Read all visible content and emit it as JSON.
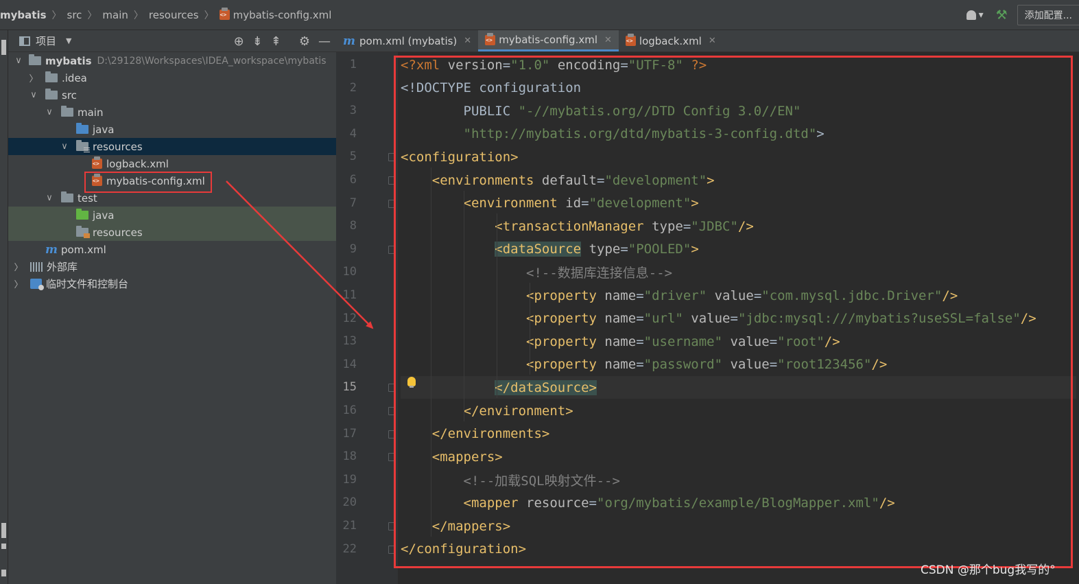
{
  "breadcrumbs": [
    "mybatis",
    "src",
    "main",
    "resources",
    "mybatis-config.xml"
  ],
  "toolbar": {
    "add_config_label": "添加配置..."
  },
  "project_panel": {
    "title": "项目",
    "tree": [
      {
        "label": "mybatis",
        "path": "D:\\29128\\Workspaces\\IDEA_workspace\\mybatis",
        "arrow": "∨",
        "icon": "module-folder-icon"
      },
      {
        "label": ".idea",
        "arrow": "〉",
        "icon": "folder-icon"
      },
      {
        "label": "src",
        "arrow": "∨",
        "icon": "folder-icon"
      },
      {
        "label": "main",
        "arrow": "∨",
        "icon": "folder-icon"
      },
      {
        "label": "java",
        "icon": "source-folder-icon"
      },
      {
        "label": "resources",
        "arrow": "∨",
        "icon": "resources-folder-icon"
      },
      {
        "label": "logback.xml",
        "icon": "xml-file-icon"
      },
      {
        "label": "mybatis-config.xml",
        "icon": "xml-file-icon"
      },
      {
        "label": "test",
        "arrow": "∨",
        "icon": "folder-icon"
      },
      {
        "label": "java",
        "icon": "test-source-folder-icon"
      },
      {
        "label": "resources",
        "icon": "test-resources-folder-icon"
      },
      {
        "label": "pom.xml",
        "icon": "maven-icon"
      },
      {
        "label": "外部库",
        "arrow": "〉",
        "icon": "libraries-icon"
      },
      {
        "label": "临时文件和控制台",
        "arrow": "〉",
        "icon": "scratches-icon"
      }
    ]
  },
  "tabs": [
    {
      "label": "pom.xml (mybatis)",
      "icon": "maven-icon",
      "active": false
    },
    {
      "label": "mybatis-config.xml",
      "icon": "xml-file-icon",
      "active": true
    },
    {
      "label": "logback.xml",
      "icon": "xml-file-icon",
      "active": false
    }
  ],
  "editor": {
    "current_line": 15,
    "lines": [
      [
        [
          "dt",
          "<?xml "
        ],
        [
          "attr",
          "version"
        ],
        [
          "txt",
          "="
        ],
        [
          "val",
          "\"1.0\""
        ],
        [
          "txt",
          " "
        ],
        [
          "attr",
          "encoding"
        ],
        [
          "txt",
          "="
        ],
        [
          "val",
          "\"UTF-8\""
        ],
        [
          "dt",
          " ?>"
        ]
      ],
      [
        [
          "txt",
          "<!DOCTYPE configuration"
        ]
      ],
      [
        [
          "txt",
          "        PUBLIC "
        ],
        [
          "val",
          "\"-//mybatis.org//DTD Config 3.0//EN\""
        ]
      ],
      [
        [
          "txt",
          "        "
        ],
        [
          "val",
          "\"http://mybatis.org/dtd/mybatis-3-config.dtd\""
        ],
        [
          "txt",
          ">"
        ]
      ],
      [
        [
          "tag",
          "<configuration>"
        ]
      ],
      [
        [
          "txt",
          "    "
        ],
        [
          "tag",
          "<environments "
        ],
        [
          "attr",
          "default"
        ],
        [
          "txt",
          "="
        ],
        [
          "val",
          "\"development\""
        ],
        [
          "tag",
          ">"
        ]
      ],
      [
        [
          "txt",
          "        "
        ],
        [
          "tag",
          "<environment "
        ],
        [
          "attr",
          "id"
        ],
        [
          "txt",
          "="
        ],
        [
          "val",
          "\"development\""
        ],
        [
          "tag",
          ">"
        ]
      ],
      [
        [
          "txt",
          "            "
        ],
        [
          "tag",
          "<transactionManager "
        ],
        [
          "attr",
          "type"
        ],
        [
          "txt",
          "="
        ],
        [
          "val",
          "\"JDBC\""
        ],
        [
          "tag",
          "/>"
        ]
      ],
      [
        [
          "txt",
          "            "
        ],
        [
          "match",
          "<dataSource"
        ],
        [
          "txt",
          " "
        ],
        [
          "attr",
          "type"
        ],
        [
          "txt",
          "="
        ],
        [
          "val",
          "\"POOLED\""
        ],
        [
          "tag",
          ">"
        ]
      ],
      [
        [
          "txt",
          "                "
        ],
        [
          "cm",
          "<!--数据库连接信息-->"
        ]
      ],
      [
        [
          "txt",
          "                "
        ],
        [
          "tag",
          "<property "
        ],
        [
          "attr",
          "name"
        ],
        [
          "txt",
          "="
        ],
        [
          "val",
          "\"driver\""
        ],
        [
          "txt",
          " "
        ],
        [
          "attr",
          "value"
        ],
        [
          "txt",
          "="
        ],
        [
          "val",
          "\"com.mysql.jdbc.Driver\""
        ],
        [
          "tag",
          "/>"
        ]
      ],
      [
        [
          "txt",
          "                "
        ],
        [
          "tag",
          "<property "
        ],
        [
          "attr",
          "name"
        ],
        [
          "txt",
          "="
        ],
        [
          "val",
          "\"url\""
        ],
        [
          "txt",
          " "
        ],
        [
          "attr",
          "value"
        ],
        [
          "txt",
          "="
        ],
        [
          "val",
          "\"jdbc:mysql:///mybatis?useSSL=false\""
        ],
        [
          "tag",
          "/>"
        ]
      ],
      [
        [
          "txt",
          "                "
        ],
        [
          "tag",
          "<property "
        ],
        [
          "attr",
          "name"
        ],
        [
          "txt",
          "="
        ],
        [
          "val",
          "\"username\""
        ],
        [
          "txt",
          " "
        ],
        [
          "attr",
          "value"
        ],
        [
          "txt",
          "="
        ],
        [
          "val",
          "\"root\""
        ],
        [
          "tag",
          "/>"
        ]
      ],
      [
        [
          "txt",
          "                "
        ],
        [
          "tag",
          "<property "
        ],
        [
          "attr",
          "name"
        ],
        [
          "txt",
          "="
        ],
        [
          "val",
          "\"password\""
        ],
        [
          "txt",
          " "
        ],
        [
          "attr",
          "value"
        ],
        [
          "txt",
          "="
        ],
        [
          "val",
          "\"root123456\""
        ],
        [
          "tag",
          "/>"
        ]
      ],
      [
        [
          "txt",
          "            "
        ],
        [
          "match",
          "</dataSource>"
        ]
      ],
      [
        [
          "txt",
          "        "
        ],
        [
          "tag",
          "</environment>"
        ]
      ],
      [
        [
          "txt",
          "    "
        ],
        [
          "tag",
          "</environments>"
        ]
      ],
      [
        [
          "txt",
          "    "
        ],
        [
          "tag",
          "<mappers>"
        ]
      ],
      [
        [
          "txt",
          "        "
        ],
        [
          "cm",
          "<!--加载SQL映射文件-->"
        ]
      ],
      [
        [
          "txt",
          "        "
        ],
        [
          "tag",
          "<mapper "
        ],
        [
          "attr",
          "resource"
        ],
        [
          "txt",
          "="
        ],
        [
          "val",
          "\"org/mybatis/example/BlogMapper.xml\""
        ],
        [
          "tag",
          "/>"
        ]
      ],
      [
        [
          "txt",
          "    "
        ],
        [
          "tag",
          "</mappers>"
        ]
      ],
      [
        [
          "tag",
          "</configuration>"
        ]
      ]
    ]
  },
  "watermark": "CSDN @那个bug我写的°",
  "colors": {
    "highlight_box": "#e83a3a",
    "tag": "#e8bf6a",
    "string": "#6a8759",
    "comment": "#808080"
  }
}
